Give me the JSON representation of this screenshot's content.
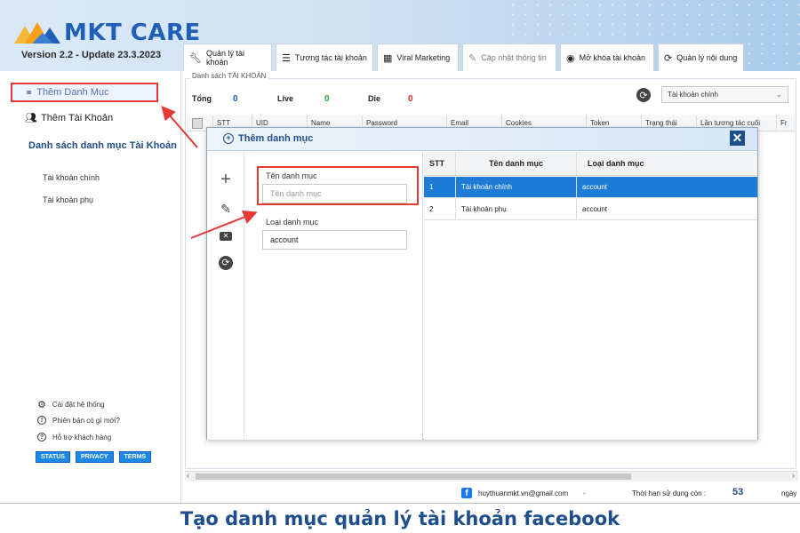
{
  "header": {
    "logo_text": "MKT CARE",
    "version": "Version 2.2 - Update 23.3.2023"
  },
  "tabs": [
    {
      "label": "Quản lý tài khoản",
      "icon": "wrench-icon"
    },
    {
      "label": "Tương tác tài khoản",
      "icon": "list-icon"
    },
    {
      "label": "Viral Marketing",
      "icon": "calculator-icon"
    },
    {
      "label": "Cập nhật thông tin",
      "icon": "pencil-icon"
    },
    {
      "label": "Mở khóa tài khoản",
      "icon": "user-circle-icon"
    },
    {
      "label": "Quản lý nội dung",
      "icon": "refresh-eye-icon"
    }
  ],
  "sidebar": {
    "add_category": "Thêm Danh Mục",
    "add_account": "Thêm Tài Khoản",
    "category_list_title": "Danh sách danh mục Tài Khoản",
    "categories": [
      "Tài khoản chính",
      "Tài khoản phụ"
    ],
    "bottom": [
      {
        "label": "Cài đặt hệ thống",
        "icon": "gear-icon"
      },
      {
        "label": "Phiên bản có gì mới?",
        "icon": "info-icon"
      },
      {
        "label": "Hỗ trợ khách hàng",
        "icon": "help-icon"
      }
    ],
    "buttons": [
      "STATUS",
      "PRIVACY",
      "TERMS"
    ]
  },
  "main": {
    "group_label": "Danh sách TÀI KHOẢN",
    "stats": {
      "total_label": "Tổng",
      "total": "0",
      "live_label": "Live",
      "live": "0",
      "die_label": "Die",
      "die": "0"
    },
    "account_select": "Tài khoản chính",
    "columns": [
      "STT",
      "UID",
      "Name",
      "Password",
      "Email",
      "Cookies",
      "Token",
      "Trạng thái",
      "Lần tương tác cuối",
      "Fr"
    ]
  },
  "modal": {
    "title": "Thêm danh mục",
    "name_label": "Tên danh mục",
    "name_placeholder": "Tên danh mục",
    "type_label": "Loại danh mục",
    "type_value": "account",
    "table_headers": [
      "STT",
      "Tên danh mục",
      "Loại danh mục"
    ],
    "rows": [
      {
        "stt": "1",
        "name": "Tài khoản chính",
        "type": "account"
      },
      {
        "stt": "2",
        "name": "Tài khoản phụ",
        "type": "account"
      }
    ]
  },
  "status_bar": {
    "email": "huythuanmkt.vn@gmail.com",
    "dash": "-",
    "expiry_label": "Thời hạn sử dụng còn :",
    "expiry_value": "53",
    "expiry_unit": "ngày"
  },
  "caption": "Tạo danh mục quản lý tài khoản facebook",
  "colors": {
    "brand": "#1f5fb8",
    "highlight": "#e53935",
    "selected_row": "#1e7bd6",
    "title_blue": "#1f4e8c"
  }
}
